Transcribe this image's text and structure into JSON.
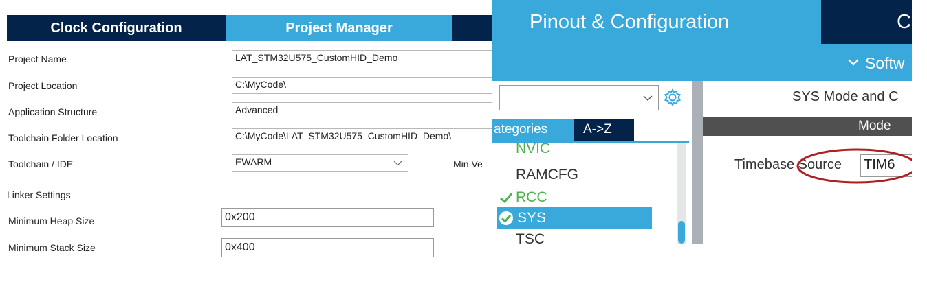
{
  "left": {
    "tabs": {
      "clock": "Clock Configuration",
      "project": "Project Manager"
    },
    "fields": {
      "project_name": {
        "label": "Project Name",
        "value": "LAT_STM32U575_CustomHID_Demo"
      },
      "project_location": {
        "label": "Project Location",
        "value": "C:\\MyCode\\"
      },
      "app_structure": {
        "label": "Application Structure",
        "value": "Advanced"
      },
      "toolchain_folder": {
        "label": "Toolchain Folder Location",
        "value": "C:\\MyCode\\LAT_STM32U575_CustomHID_Demo\\"
      },
      "toolchain_ide": {
        "label": "Toolchain / IDE",
        "value": "EWARM",
        "extra_label": "Min Ve"
      }
    },
    "linker": {
      "title": "Linker Settings",
      "heap": {
        "label": "Minimum Heap Size",
        "value": "0x200"
      },
      "stack": {
        "label": "Minimum Stack Size",
        "value": "0x400"
      }
    }
  },
  "right": {
    "tabs": {
      "pinout": "Pinout & Configuration",
      "next": "C"
    },
    "software_label": "Softw",
    "category_tabs": {
      "categories": "ategories",
      "az": "A->Z"
    },
    "list": [
      {
        "label": "NVIC",
        "state": "partial"
      },
      {
        "label": "RAMCFG",
        "state": "normal"
      },
      {
        "label": "RCC",
        "state": "checked"
      },
      {
        "label": "SYS",
        "state": "selected"
      },
      {
        "label": "TSC",
        "state": "partial"
      }
    ],
    "sys_title": "SYS Mode and C",
    "mode_header": "Mode",
    "timebase_label": "Timebase Source",
    "timebase_value": "TIM6",
    "colors": {
      "dark_navy": "#03234b",
      "light_blue": "#39a9dc",
      "selected": "#39a9dc",
      "green": "#4db34d",
      "highlight_circle": "#b01e22"
    }
  }
}
